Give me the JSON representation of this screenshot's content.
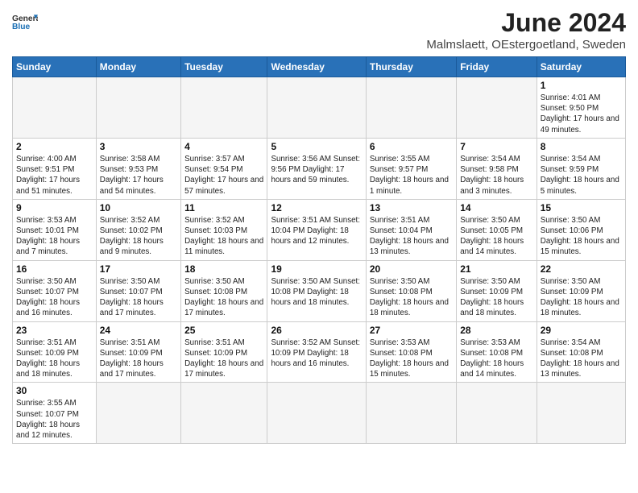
{
  "logo": {
    "text_general": "General",
    "text_blue": "Blue"
  },
  "title": "June 2024",
  "subtitle": "Malmslaett, OEstergoetland, Sweden",
  "headers": [
    "Sunday",
    "Monday",
    "Tuesday",
    "Wednesday",
    "Thursday",
    "Friday",
    "Saturday"
  ],
  "weeks": [
    [
      {
        "day": "",
        "info": ""
      },
      {
        "day": "",
        "info": ""
      },
      {
        "day": "",
        "info": ""
      },
      {
        "day": "",
        "info": ""
      },
      {
        "day": "",
        "info": ""
      },
      {
        "day": "",
        "info": ""
      },
      {
        "day": "1",
        "info": "Sunrise: 4:01 AM\nSunset: 9:50 PM\nDaylight: 17 hours and 49 minutes."
      }
    ],
    [
      {
        "day": "2",
        "info": "Sunrise: 4:00 AM\nSunset: 9:51 PM\nDaylight: 17 hours and 51 minutes."
      },
      {
        "day": "3",
        "info": "Sunrise: 3:58 AM\nSunset: 9:53 PM\nDaylight: 17 hours and 54 minutes."
      },
      {
        "day": "4",
        "info": "Sunrise: 3:57 AM\nSunset: 9:54 PM\nDaylight: 17 hours and 57 minutes."
      },
      {
        "day": "5",
        "info": "Sunrise: 3:56 AM\nSunset: 9:56 PM\nDaylight: 17 hours and 59 minutes."
      },
      {
        "day": "6",
        "info": "Sunrise: 3:55 AM\nSunset: 9:57 PM\nDaylight: 18 hours and 1 minute."
      },
      {
        "day": "7",
        "info": "Sunrise: 3:54 AM\nSunset: 9:58 PM\nDaylight: 18 hours and 3 minutes."
      },
      {
        "day": "8",
        "info": "Sunrise: 3:54 AM\nSunset: 9:59 PM\nDaylight: 18 hours and 5 minutes."
      }
    ],
    [
      {
        "day": "9",
        "info": "Sunrise: 3:53 AM\nSunset: 10:01 PM\nDaylight: 18 hours and 7 minutes."
      },
      {
        "day": "10",
        "info": "Sunrise: 3:52 AM\nSunset: 10:02 PM\nDaylight: 18 hours and 9 minutes."
      },
      {
        "day": "11",
        "info": "Sunrise: 3:52 AM\nSunset: 10:03 PM\nDaylight: 18 hours and 11 minutes."
      },
      {
        "day": "12",
        "info": "Sunrise: 3:51 AM\nSunset: 10:04 PM\nDaylight: 18 hours and 12 minutes."
      },
      {
        "day": "13",
        "info": "Sunrise: 3:51 AM\nSunset: 10:04 PM\nDaylight: 18 hours and 13 minutes."
      },
      {
        "day": "14",
        "info": "Sunrise: 3:50 AM\nSunset: 10:05 PM\nDaylight: 18 hours and 14 minutes."
      },
      {
        "day": "15",
        "info": "Sunrise: 3:50 AM\nSunset: 10:06 PM\nDaylight: 18 hours and 15 minutes."
      }
    ],
    [
      {
        "day": "16",
        "info": "Sunrise: 3:50 AM\nSunset: 10:07 PM\nDaylight: 18 hours and 16 minutes."
      },
      {
        "day": "17",
        "info": "Sunrise: 3:50 AM\nSunset: 10:07 PM\nDaylight: 18 hours and 17 minutes."
      },
      {
        "day": "18",
        "info": "Sunrise: 3:50 AM\nSunset: 10:08 PM\nDaylight: 18 hours and 17 minutes."
      },
      {
        "day": "19",
        "info": "Sunrise: 3:50 AM\nSunset: 10:08 PM\nDaylight: 18 hours and 18 minutes."
      },
      {
        "day": "20",
        "info": "Sunrise: 3:50 AM\nSunset: 10:08 PM\nDaylight: 18 hours and 18 minutes."
      },
      {
        "day": "21",
        "info": "Sunrise: 3:50 AM\nSunset: 10:09 PM\nDaylight: 18 hours and 18 minutes."
      },
      {
        "day": "22",
        "info": "Sunrise: 3:50 AM\nSunset: 10:09 PM\nDaylight: 18 hours and 18 minutes."
      }
    ],
    [
      {
        "day": "23",
        "info": "Sunrise: 3:51 AM\nSunset: 10:09 PM\nDaylight: 18 hours and 18 minutes."
      },
      {
        "day": "24",
        "info": "Sunrise: 3:51 AM\nSunset: 10:09 PM\nDaylight: 18 hours and 17 minutes."
      },
      {
        "day": "25",
        "info": "Sunrise: 3:51 AM\nSunset: 10:09 PM\nDaylight: 18 hours and 17 minutes."
      },
      {
        "day": "26",
        "info": "Sunrise: 3:52 AM\nSunset: 10:09 PM\nDaylight: 18 hours and 16 minutes."
      },
      {
        "day": "27",
        "info": "Sunrise: 3:53 AM\nSunset: 10:08 PM\nDaylight: 18 hours and 15 minutes."
      },
      {
        "day": "28",
        "info": "Sunrise: 3:53 AM\nSunset: 10:08 PM\nDaylight: 18 hours and 14 minutes."
      },
      {
        "day": "29",
        "info": "Sunrise: 3:54 AM\nSunset: 10:08 PM\nDaylight: 18 hours and 13 minutes."
      }
    ],
    [
      {
        "day": "30",
        "info": "Sunrise: 3:55 AM\nSunset: 10:07 PM\nDaylight: 18 hours and 12 minutes."
      },
      {
        "day": "",
        "info": ""
      },
      {
        "day": "",
        "info": ""
      },
      {
        "day": "",
        "info": ""
      },
      {
        "day": "",
        "info": ""
      },
      {
        "day": "",
        "info": ""
      },
      {
        "day": "",
        "info": ""
      }
    ]
  ]
}
